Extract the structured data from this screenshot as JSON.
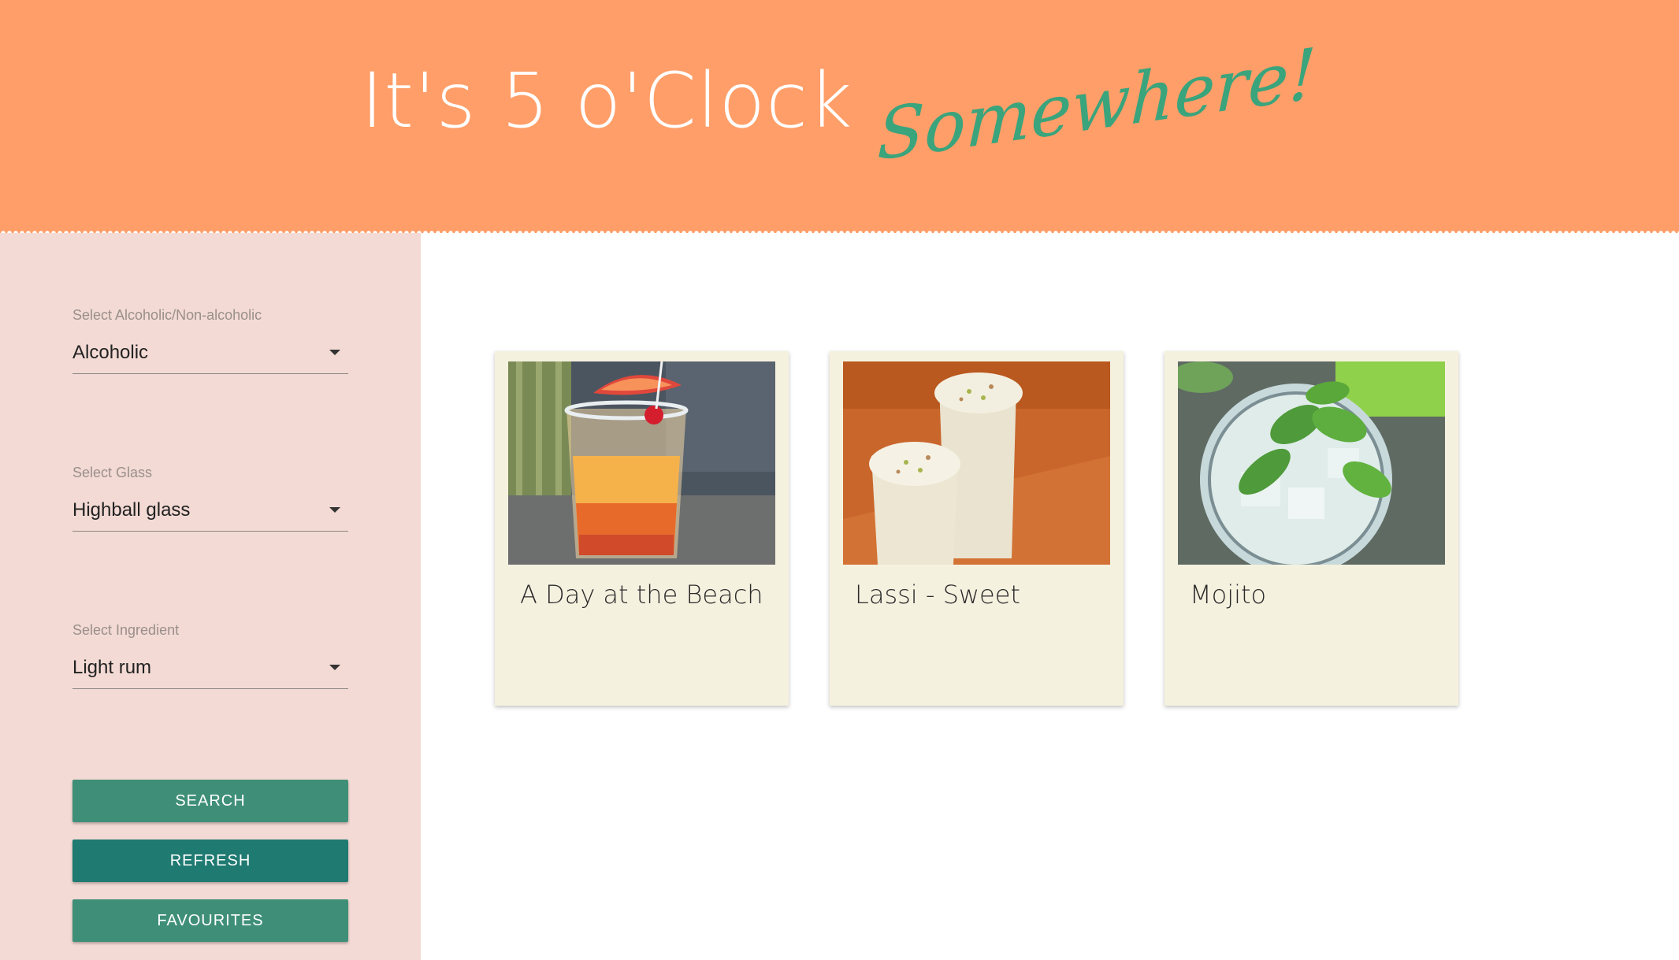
{
  "header": {
    "title_main": "It's 5 o'Clock",
    "title_script": "Somewhere!"
  },
  "filters": {
    "alcoholic": {
      "label": "Select Alcoholic/Non-alcoholic",
      "value": "Alcoholic"
    },
    "glass": {
      "label": "Select Glass",
      "value": "Highball glass"
    },
    "ingredient": {
      "label": "Select Ingredient",
      "value": "Light rum"
    }
  },
  "buttons": {
    "search": "SEARCH",
    "refresh": "REFRESH",
    "favourites": "FAVOURITES"
  },
  "cards": [
    {
      "name": "A Day at the Beach"
    },
    {
      "name": "Lassi - Sweet"
    },
    {
      "name": "Mojito"
    }
  ],
  "colors": {
    "header_bg": "#ff9e68",
    "script_accent": "#3aa47c",
    "sidebar_bg": "#f3dad4",
    "button_primary": "#3f8f78",
    "button_refresh": "#1f7a72",
    "card_bg": "#f5f1df"
  }
}
